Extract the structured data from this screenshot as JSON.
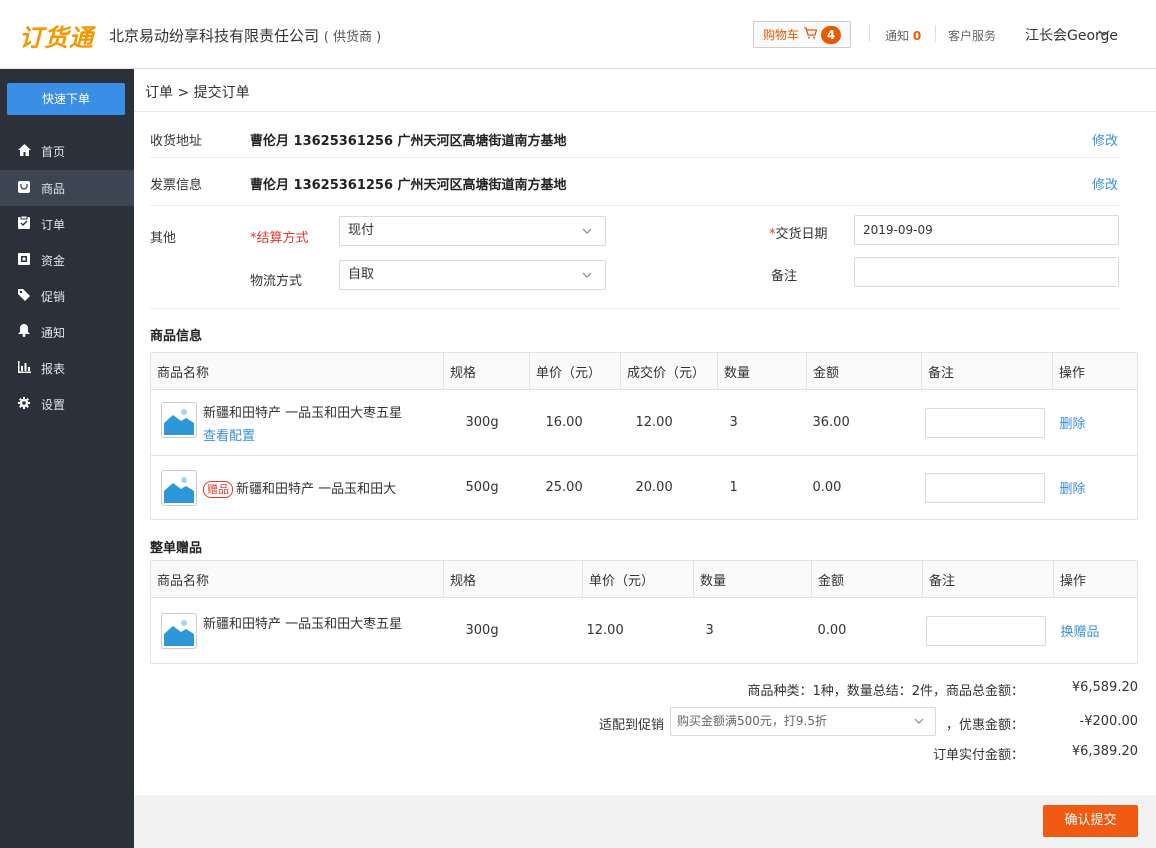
{
  "header": {
    "logo": "订货通",
    "company": "北京易动纷享科技有限责任公司",
    "company_tag": "( 供货商 )",
    "cart_label": "购物车",
    "cart_count": "4",
    "notice_label": "通知",
    "notice_count": "0",
    "service_label": "客户服务",
    "user_name": "江长会George"
  },
  "sidebar": {
    "quick_order": "快速下单",
    "items": [
      {
        "label": "首页",
        "icon": "home-icon"
      },
      {
        "label": "商品",
        "icon": "bag-icon",
        "active": true
      },
      {
        "label": "订单",
        "icon": "clipboard-icon"
      },
      {
        "label": "资金",
        "icon": "wallet-icon"
      },
      {
        "label": "促销",
        "icon": "tag-icon"
      },
      {
        "label": "通知",
        "icon": "bell-icon"
      },
      {
        "label": "报表",
        "icon": "bar-chart-icon"
      },
      {
        "label": "设置",
        "icon": "gear-icon"
      }
    ]
  },
  "main": {
    "breadcrumb": "订单 > 提交订单",
    "address_label": "收货地址",
    "address_value": "曹伦月  13625361256  广州天河区高塘街道南方基地",
    "invoice_label": "发票信息",
    "invoice_value": "曹伦月  13625361256  广州天河区高塘街道南方基地",
    "edit_label": "修改",
    "other_label": "其他",
    "settlement_label": "*结算方式",
    "settlement_value": "现付",
    "logistics_label": "物流方式",
    "logistics_value": "自取",
    "delivery_date_label": "交货日期",
    "delivery_date_value": "2019-09-09",
    "remark_label": "备注"
  },
  "goods": {
    "title": "商品信息",
    "columns": [
      "商品名称",
      "规格",
      "单价（元）",
      "成交价（元）",
      "数量",
      "金额",
      "备注",
      "操作"
    ],
    "rows": [
      {
        "name": "新疆和田特产 一品玉和田大枣五星",
        "config_link": "查看配置",
        "spec": "300g",
        "unit_price": "16.00",
        "deal_price": "12.00",
        "qty": "3",
        "amount": "36.00",
        "action": "删除"
      },
      {
        "gift_tag": "赠品",
        "name": "新疆和田特产 一品玉和田大",
        "spec": "500g",
        "unit_price": "25.00",
        "deal_price": "20.00",
        "qty": "1",
        "amount": "0.00",
        "action": "删除"
      }
    ]
  },
  "order_gifts": {
    "title": "整单赠品",
    "columns": [
      "商品名称",
      "规格",
      "单价（元）",
      "数量",
      "金额",
      "备注",
      "操作"
    ],
    "rows": [
      {
        "name": "新疆和田特产 一品玉和田大枣五星",
        "spec": "300g",
        "unit_price": "12.00",
        "qty": "3",
        "amount": "0.00",
        "action": "换赠品"
      }
    ]
  },
  "summary": {
    "totals_text": "商品种类：1种，数量总结：2件，商品总金额：",
    "totals_value": "¥6,589.20",
    "promo_label": "适配到促销",
    "promo_value": "购买金额满500元，打9.5折",
    "discount_label": "，优惠金额：",
    "discount_value": "-¥200.00",
    "payable_label": "订单实付金额：",
    "payable_value": "¥6,389.20"
  },
  "footer": {
    "submit": "确认提交"
  },
  "colors": {
    "brand_orange": "#f39800",
    "sidebar_bg": "#2b303b",
    "accent_blue": "#3a8ee6",
    "submit_orange": "#f05a13",
    "required_red": "#e5382c"
  }
}
